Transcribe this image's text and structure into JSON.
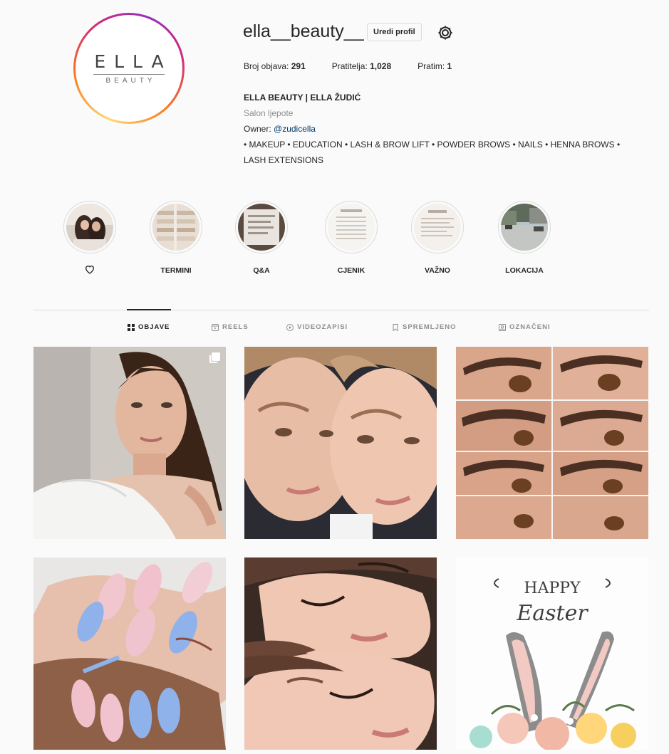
{
  "profile": {
    "username": "ella__beauty__",
    "edit_label": "Uredi profil",
    "logo_main": "ELLA",
    "logo_sub": "BEAUTY",
    "stats": {
      "posts_label": "Broj objava:",
      "posts_value": "291",
      "followers_label": "Pratitelja:",
      "followers_value": "1,028",
      "following_label": "Pratim:",
      "following_value": "1"
    },
    "bio": {
      "name": "ELLA BEAUTY | ELLA ŽUDIĆ",
      "category": "Salon ljepote",
      "owner_label": "Owner:",
      "owner_link": "@zudicella",
      "description": "• MAKEUP • EDUCATION • LASH & BROW LIFT • POWDER BROWS • NAILS • HENNA BROWS • LASH EXTENSIONS"
    }
  },
  "highlights": [
    {
      "label": "",
      "icon": "heart-icon"
    },
    {
      "label": "TERMINI"
    },
    {
      "label": "Q&A"
    },
    {
      "label": "CJENIK"
    },
    {
      "label": "VAŽNO"
    },
    {
      "label": "LOKACIJA"
    }
  ],
  "tabs": [
    {
      "label": "OBJAVE",
      "icon": "grid-icon",
      "active": true
    },
    {
      "label": "REELS",
      "icon": "reels-icon",
      "active": false
    },
    {
      "label": "VIDEOZAPISI",
      "icon": "video-icon",
      "active": false
    },
    {
      "label": "SPREMLJENO",
      "icon": "bookmark-icon",
      "active": false
    },
    {
      "label": "OZNAČENI",
      "icon": "tagged-icon",
      "active": false
    }
  ],
  "posts": [
    {
      "name": "post-portrait",
      "multi": true
    },
    {
      "name": "post-two-faces",
      "multi": false
    },
    {
      "name": "post-brow-collage",
      "multi": false
    },
    {
      "name": "post-nails",
      "multi": false
    },
    {
      "name": "post-lash-faces",
      "multi": false
    },
    {
      "name": "post-happy-easter",
      "multi": false,
      "text_line1": "HAPPY",
      "text_line2": "Easter"
    }
  ],
  "colors": {
    "text": "#262626",
    "secondary": "#8e8e8e",
    "link": "#00376b",
    "border": "#dbdbdb",
    "background": "#fafafa"
  }
}
